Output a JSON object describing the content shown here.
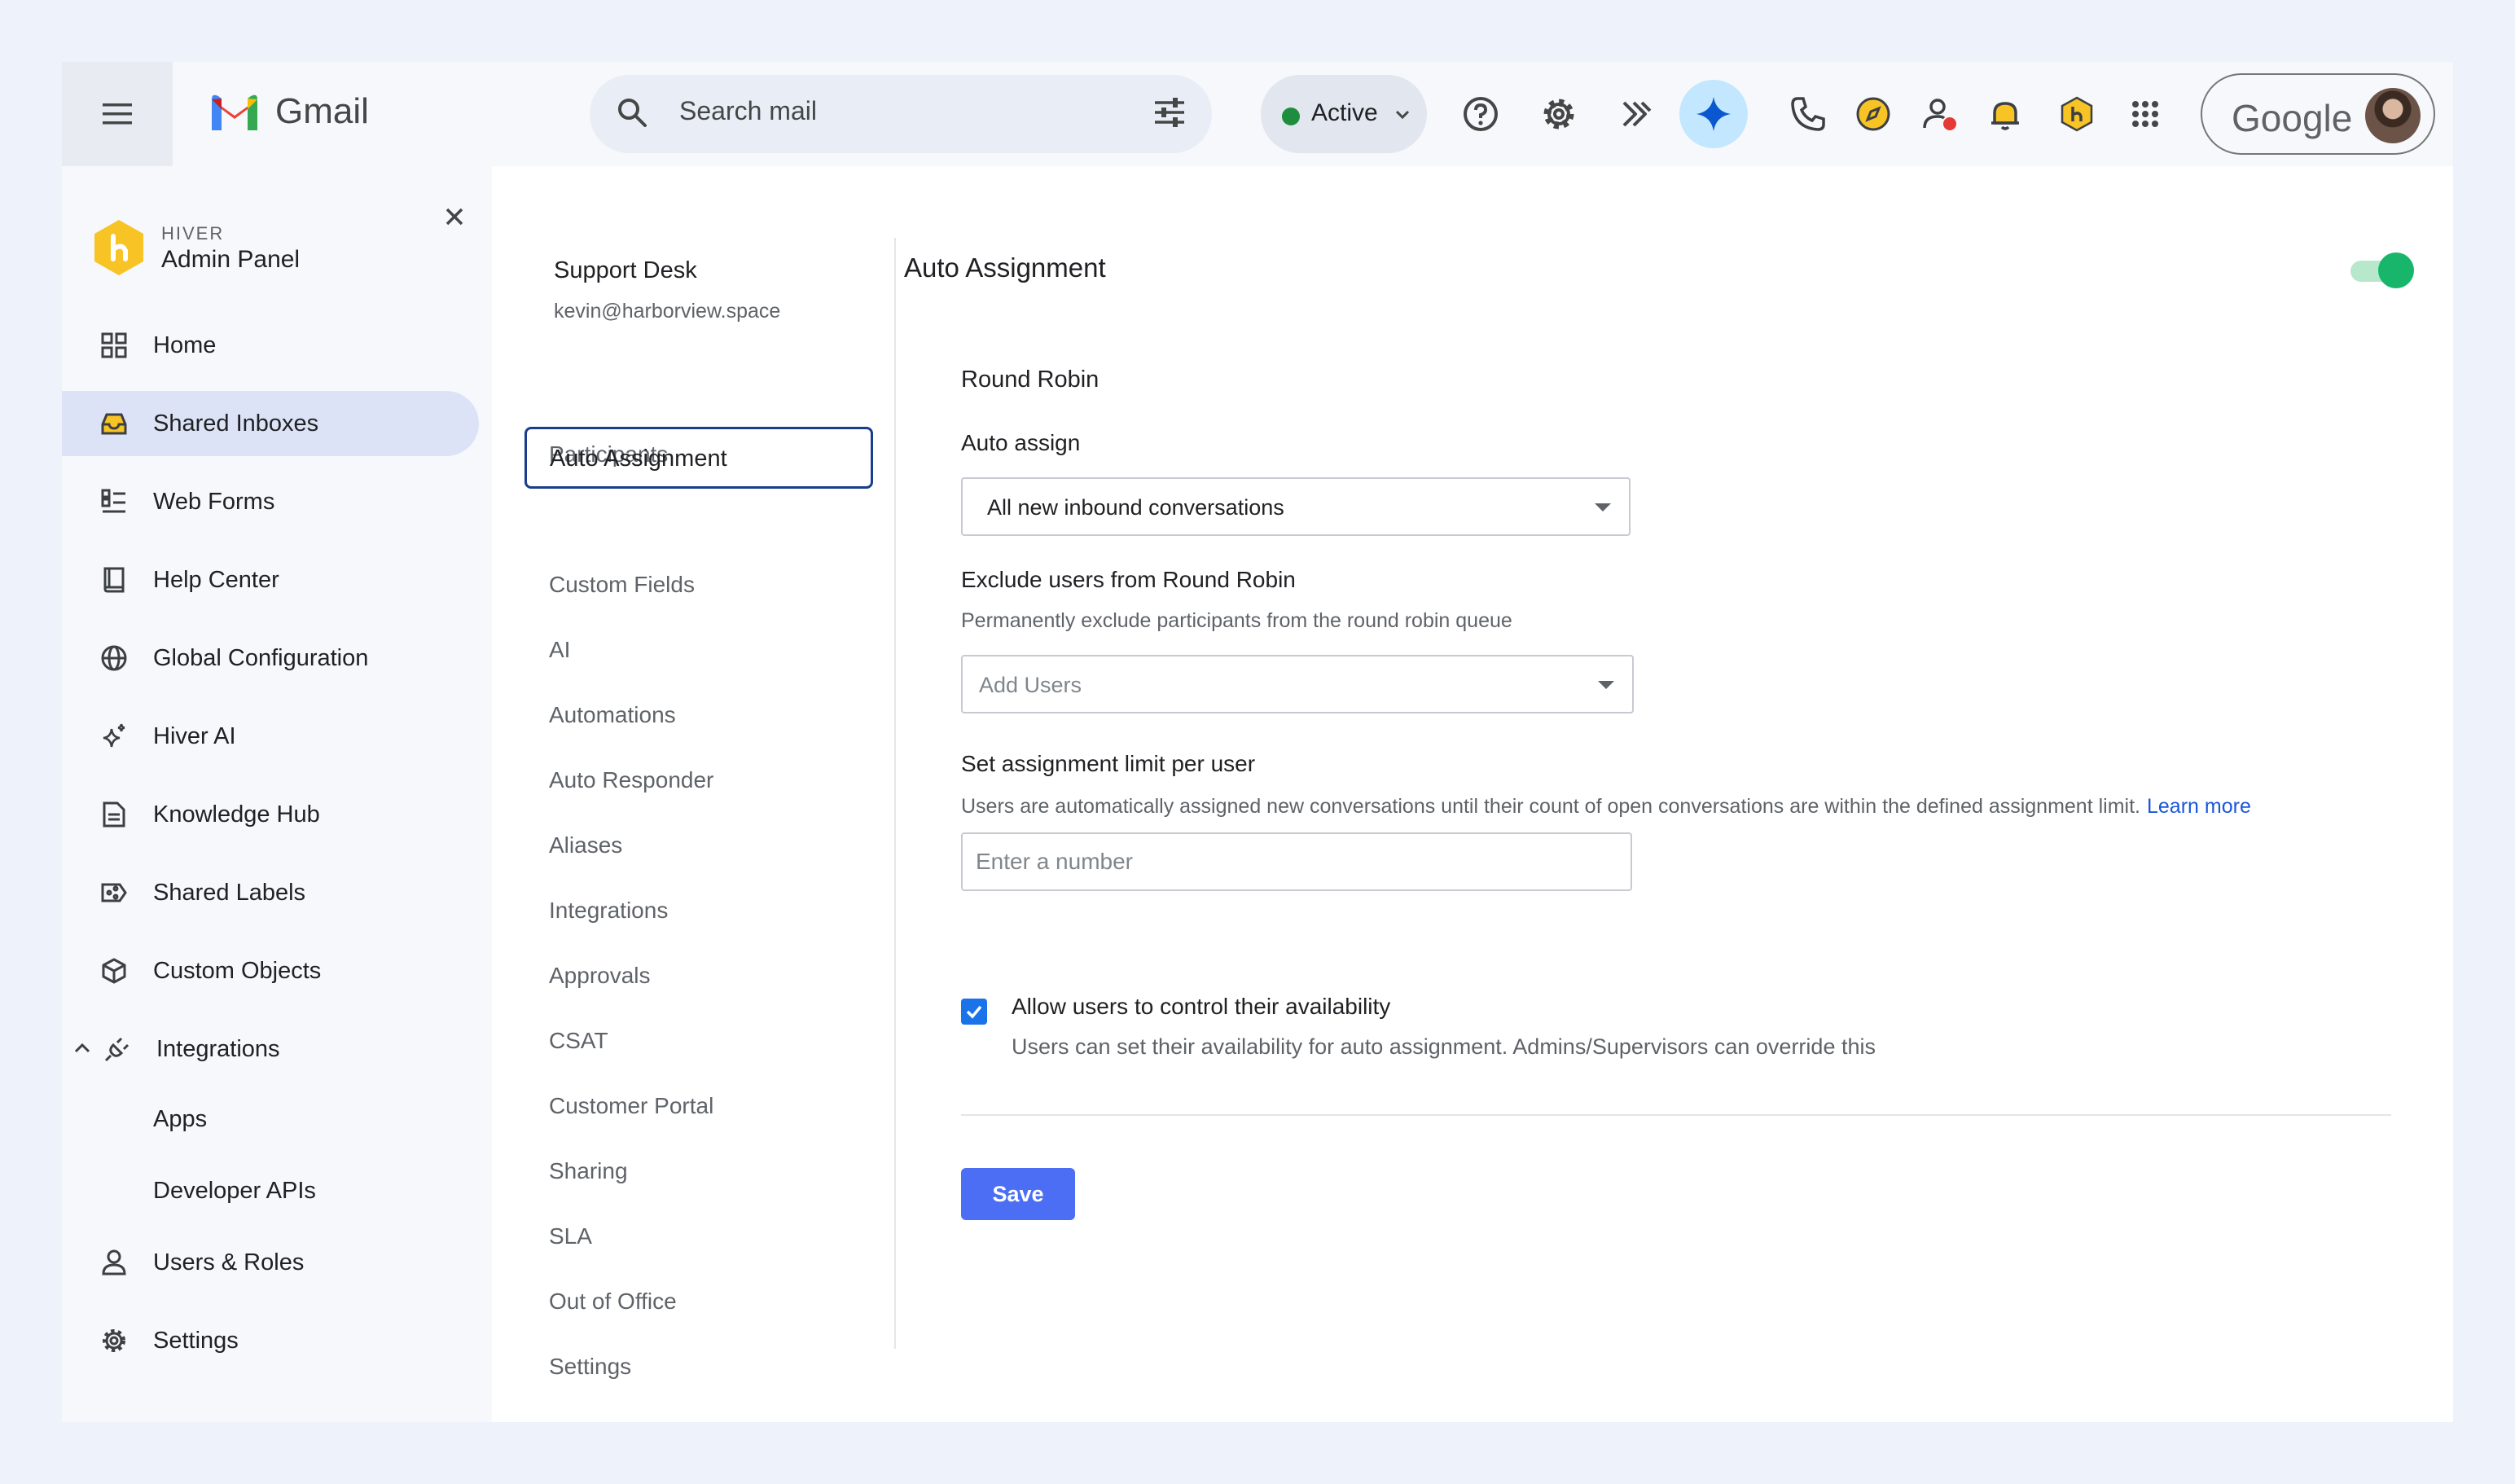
{
  "topbar": {
    "app_name": "Gmail",
    "search_placeholder": "Search mail",
    "status_label": "Active",
    "account_brand": "Google"
  },
  "sidebar": {
    "brand_small": "HIVER",
    "brand_title": "Admin Panel",
    "items": [
      {
        "label": "Home",
        "icon": "grid-icon"
      },
      {
        "label": "Shared Inboxes",
        "icon": "inbox-icon",
        "active": true
      },
      {
        "label": "Web Forms",
        "icon": "form-icon"
      },
      {
        "label": "Help Center",
        "icon": "book-icon"
      },
      {
        "label": "Global Configuration",
        "icon": "globe-icon"
      },
      {
        "label": "Hiver AI",
        "icon": "sparkle-icon"
      },
      {
        "label": "Knowledge Hub",
        "icon": "document-icon"
      },
      {
        "label": "Shared Labels",
        "icon": "label-icon"
      },
      {
        "label": "Custom Objects",
        "icon": "cube-icon"
      },
      {
        "label": "Integrations",
        "icon": "plug-icon",
        "expanded": true
      },
      {
        "label": "Users & Roles",
        "icon": "user-icon"
      },
      {
        "label": "Settings",
        "icon": "gear-icon"
      }
    ],
    "integration_children": [
      "Apps",
      "Developer APIs"
    ]
  },
  "inbox": {
    "name": "Support Desk",
    "email": "kevin@harborview.space",
    "nav": [
      "Participants",
      "Auto Assignment",
      "Custom Fields",
      "AI",
      "Automations",
      "Auto Responder",
      "Aliases",
      "Integrations",
      "Approvals",
      "CSAT",
      "Customer Portal",
      "Sharing",
      "SLA",
      "Out of Office",
      "Settings"
    ],
    "active_nav": "Auto Assignment"
  },
  "content": {
    "title": "Auto Assignment",
    "toggle_on": true,
    "section_title": "Round Robin",
    "auto_assign_label": "Auto assign",
    "auto_assign_value": "All new inbound conversations",
    "exclude_label": "Exclude users from Round Robin",
    "exclude_help": "Permanently exclude participants from the round robin queue",
    "exclude_placeholder": "Add Users",
    "limit_label": "Set assignment limit per user",
    "limit_help": "Users are automatically assigned new conversations until their count of open conversations are within the defined assignment limit.",
    "learn_more": "Learn more",
    "limit_placeholder": "Enter a number",
    "availability_label": "Allow users to control their availability",
    "availability_help": "Users can set their availability for auto assignment. Admins/Supervisors can override this",
    "availability_checked": true,
    "save_label": "Save"
  },
  "colors": {
    "accent": "#4c6ef5",
    "toggle": "#18b66a",
    "active_nav_bg": "#dde3f6",
    "link": "#1a56db"
  }
}
